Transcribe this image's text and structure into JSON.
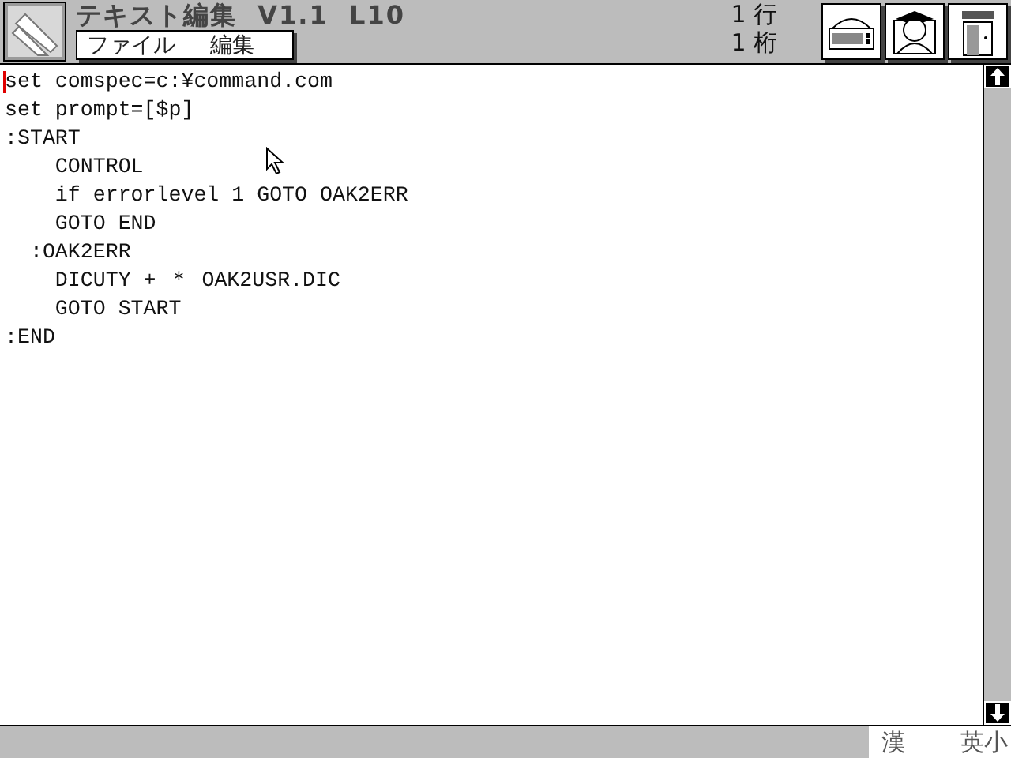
{
  "window": {
    "title": "テキスト編集  V1.1  L10"
  },
  "menu": [
    {
      "label": "ファイル"
    },
    {
      "label": "編集"
    }
  ],
  "position": {
    "row": "1 行",
    "column": "1 桁"
  },
  "editor": {
    "lines": [
      {
        "text": "set comspec=c:¥command.com",
        "cursor": true
      },
      {
        "text": "set prompt=[$p]",
        "cursor": false
      },
      {
        "text": ":START",
        "cursor": false
      },
      {
        "text": "    CONTROL",
        "cursor": false
      },
      {
        "text": "    if errorlevel 1 GOTO OAK2ERR",
        "cursor": false
      },
      {
        "text": "    GOTO END",
        "cursor": false
      },
      {
        "text": "  :OAK2ERR",
        "cursor": false
      },
      {
        "text": "    DICUTY + ＊ OAK2USR.DIC",
        "cursor": false
      },
      {
        "text": "    GOTO START",
        "cursor": false
      },
      {
        "text": ":END",
        "cursor": false
      }
    ]
  },
  "status_bar": {
    "input_mode": "漢",
    "char_mode": "英小"
  }
}
